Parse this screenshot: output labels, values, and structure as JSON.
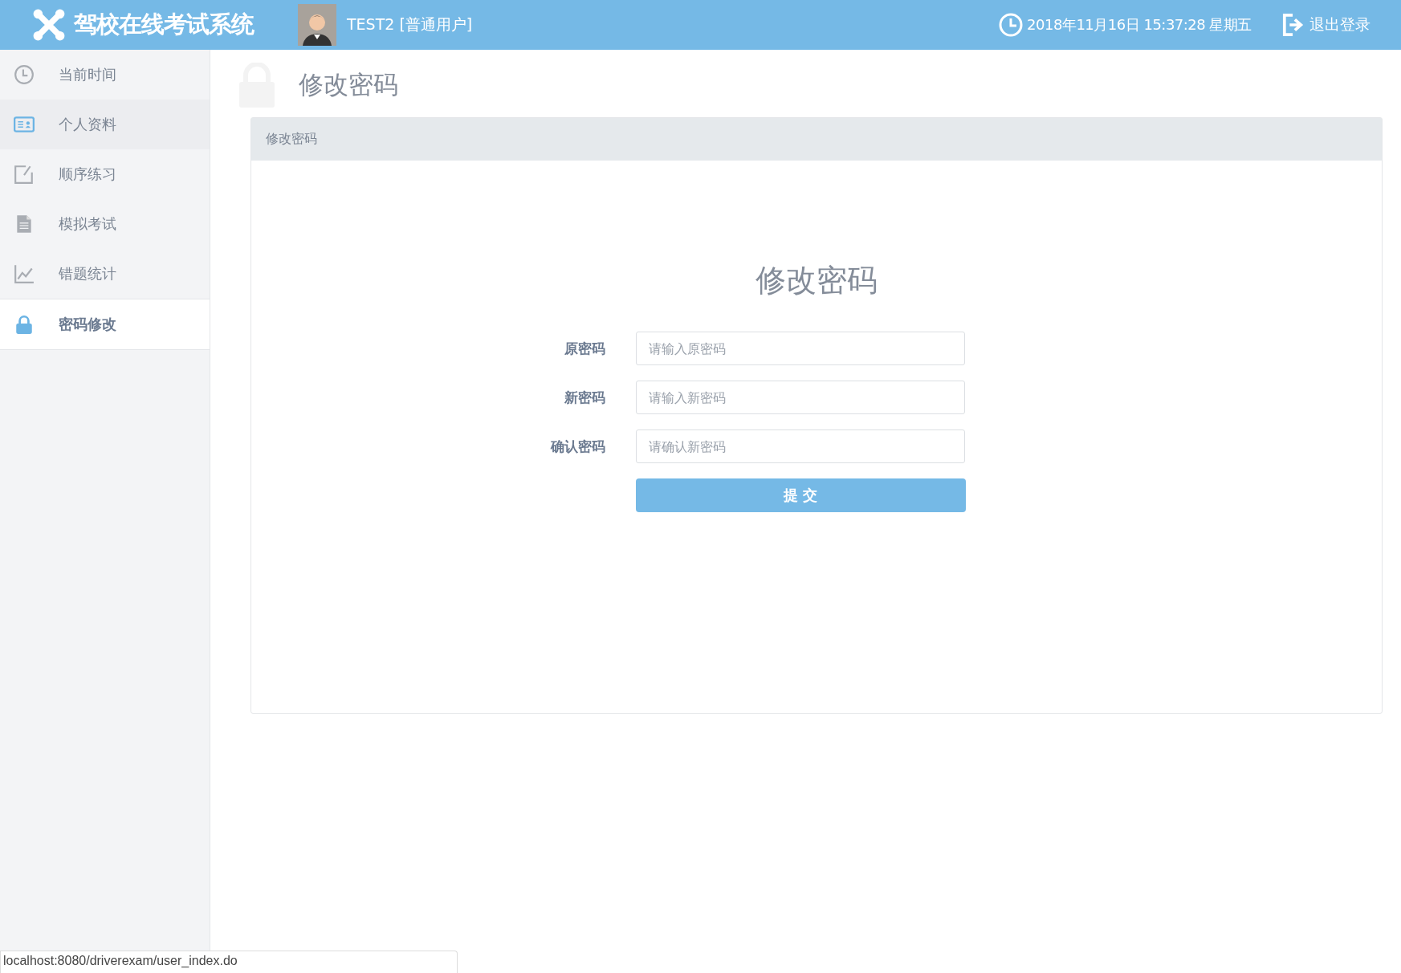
{
  "header": {
    "app_title": "驾校在线考试系统",
    "user": "TEST2 [普通用户]",
    "datetime": "2018年11月16日 15:37:28 星期五",
    "logout": "退出登录"
  },
  "sidebar": {
    "items": [
      {
        "label": "当前时间",
        "selected": false,
        "hovered": false
      },
      {
        "label": "个人资料",
        "selected": false,
        "hovered": true
      },
      {
        "label": "顺序练习",
        "selected": false,
        "hovered": false
      },
      {
        "label": "模拟考试",
        "selected": false,
        "hovered": false
      },
      {
        "label": "错题统计",
        "selected": false,
        "hovered": false
      },
      {
        "label": "密码修改",
        "selected": true,
        "hovered": false
      }
    ]
  },
  "page_title": "修改密码",
  "panel": {
    "heading": "修改密码",
    "form_title": "修改密码",
    "fields": [
      {
        "label": "原密码",
        "placeholder": "请输入原密码"
      },
      {
        "label": "新密码",
        "placeholder": "请输入新密码"
      },
      {
        "label": "确认密码",
        "placeholder": "请确认新密码"
      }
    ],
    "submit": "提 交"
  },
  "status_bar": {
    "url": "localhost:8080/driverexam/user_index.do"
  }
}
